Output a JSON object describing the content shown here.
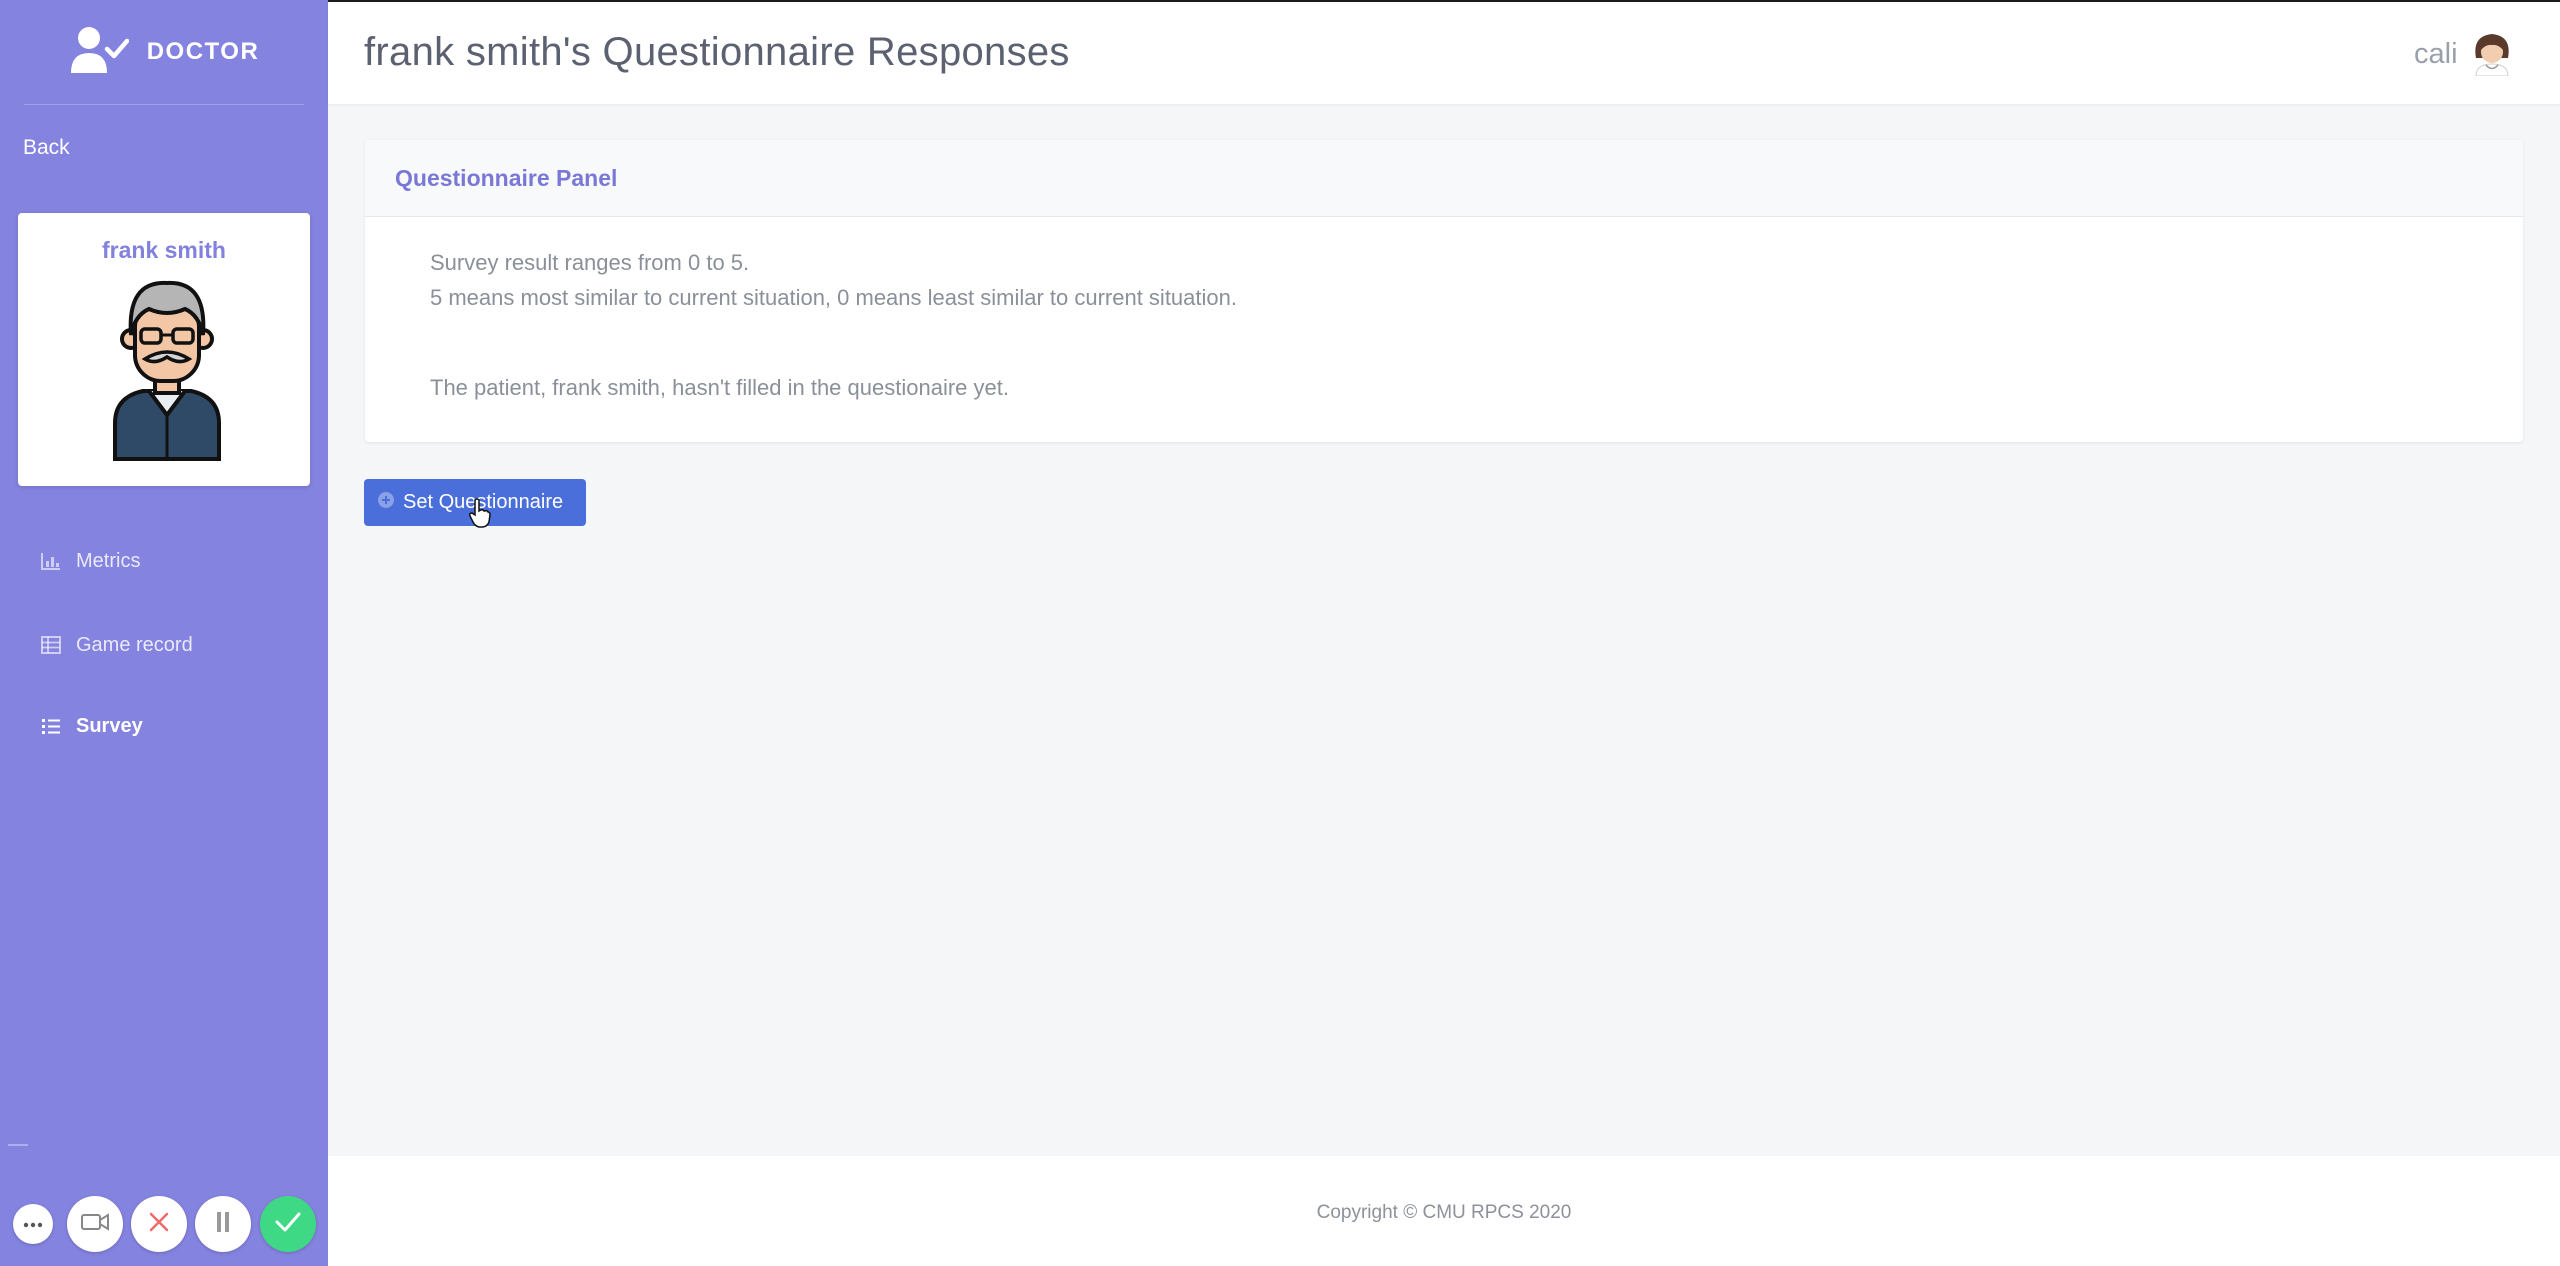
{
  "sidebar": {
    "brand": "DOCTOR",
    "back_label": "Back",
    "patient_name": "frank smith",
    "nav": [
      {
        "label": "Metrics",
        "icon": "chart-icon"
      },
      {
        "label": "Game record",
        "icon": "table-icon"
      },
      {
        "label": "Survey",
        "icon": "list-icon",
        "active": true
      }
    ]
  },
  "header": {
    "title": "frank smith's Questionnaire Responses",
    "user_name": "cali"
  },
  "panel": {
    "title": "Questionnaire Panel",
    "lines": [
      "Survey result ranges from 0 to 5.",
      "5 means most similar to current situation, 0 means least similar to current situation.",
      "The patient, frank smith, hasn't filled in the questionaire yet."
    ]
  },
  "actions": {
    "set_questionnaire": "Set Questionnaire"
  },
  "footer": {
    "copyright": "Copyright © CMU RPCS 2020"
  },
  "call_controls": [
    "more-icon",
    "video-icon",
    "close-icon",
    "pause-icon",
    "check-icon"
  ],
  "colors": {
    "sidebar": "#8483df",
    "accent": "#7a78d6",
    "primary_button": "#4a6fdb",
    "confirm": "#3fd885"
  }
}
